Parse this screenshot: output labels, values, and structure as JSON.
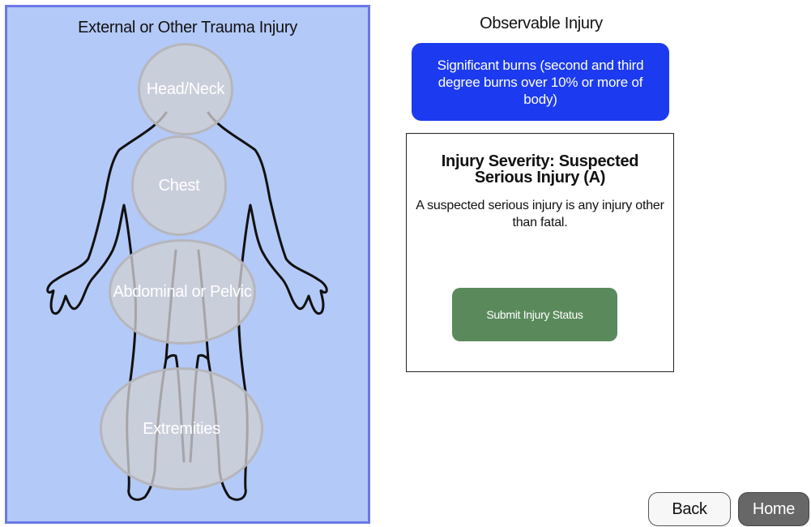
{
  "left_panel": {
    "title": "External or Other Trauma Injury",
    "regions": {
      "head_neck": "Head/Neck",
      "chest": "Chest",
      "abdominal_pelvic": "Abdominal or Pelvic",
      "extremities": "Extremities"
    }
  },
  "right_panel": {
    "title": "Observable Injury",
    "selected_injury": "Significant burns (second and third degree burns over 10% or more of body)",
    "severity": {
      "title": "Injury Severity: Suspected Serious Injury (A)",
      "description": "A suspected serious injury is any injury other than fatal."
    },
    "submit_label": "Submit Injury Status"
  },
  "nav": {
    "back_label": "Back",
    "home_label": "Home"
  },
  "colors": {
    "panel_bg": "#b3c9f7",
    "panel_border": "#6a78e8",
    "selected_injury_bg": "#1c3bf0",
    "submit_bg": "#5a8a5c",
    "home_bg": "#676767"
  }
}
